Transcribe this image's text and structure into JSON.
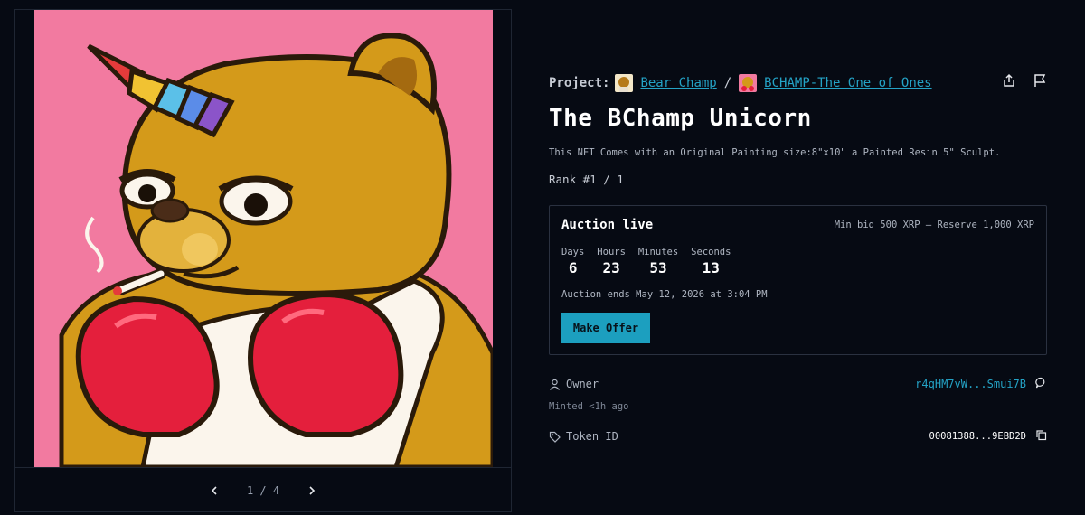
{
  "media": {
    "artwork_alt": "BChamp Unicorn bear artwork",
    "pager": {
      "current": "1 / 4"
    }
  },
  "project": {
    "label": "Project:",
    "collection": "Bear Champ",
    "separator": "/",
    "sub_collection": "BCHAMP-The One of Ones"
  },
  "actions": {
    "share_icon": "share-icon",
    "flag_icon": "flag-icon"
  },
  "nft": {
    "title": "The BChamp Unicorn",
    "description": "This NFT Comes with an Original Painting size:8\"x10\" a Painted Resin 5\" Sculpt.",
    "rank": "Rank #1 / 1"
  },
  "auction": {
    "status": "Auction live",
    "bid_info": "Min bid 500 XRP — Reserve 1,000 XRP",
    "countdown": [
      {
        "unit": "Days",
        "value": "6"
      },
      {
        "unit": "Hours",
        "value": "23"
      },
      {
        "unit": "Minutes",
        "value": "53"
      },
      {
        "unit": "Seconds",
        "value": "13"
      }
    ],
    "ends": "Auction ends May 12, 2026 at 3:04 PM",
    "offer_button": "Make Offer"
  },
  "owner": {
    "label": "Owner",
    "address": "r4qHM7vW...Smui7B",
    "minted": "Minted <1h ago"
  },
  "token": {
    "label": "Token ID",
    "value": "00081388...9EBD2D"
  },
  "colors": {
    "background": "#060a13",
    "accent": "#1c9fbf",
    "link": "#24a3c6",
    "art_background": "#f27aa0",
    "bear": "#d4a017"
  }
}
